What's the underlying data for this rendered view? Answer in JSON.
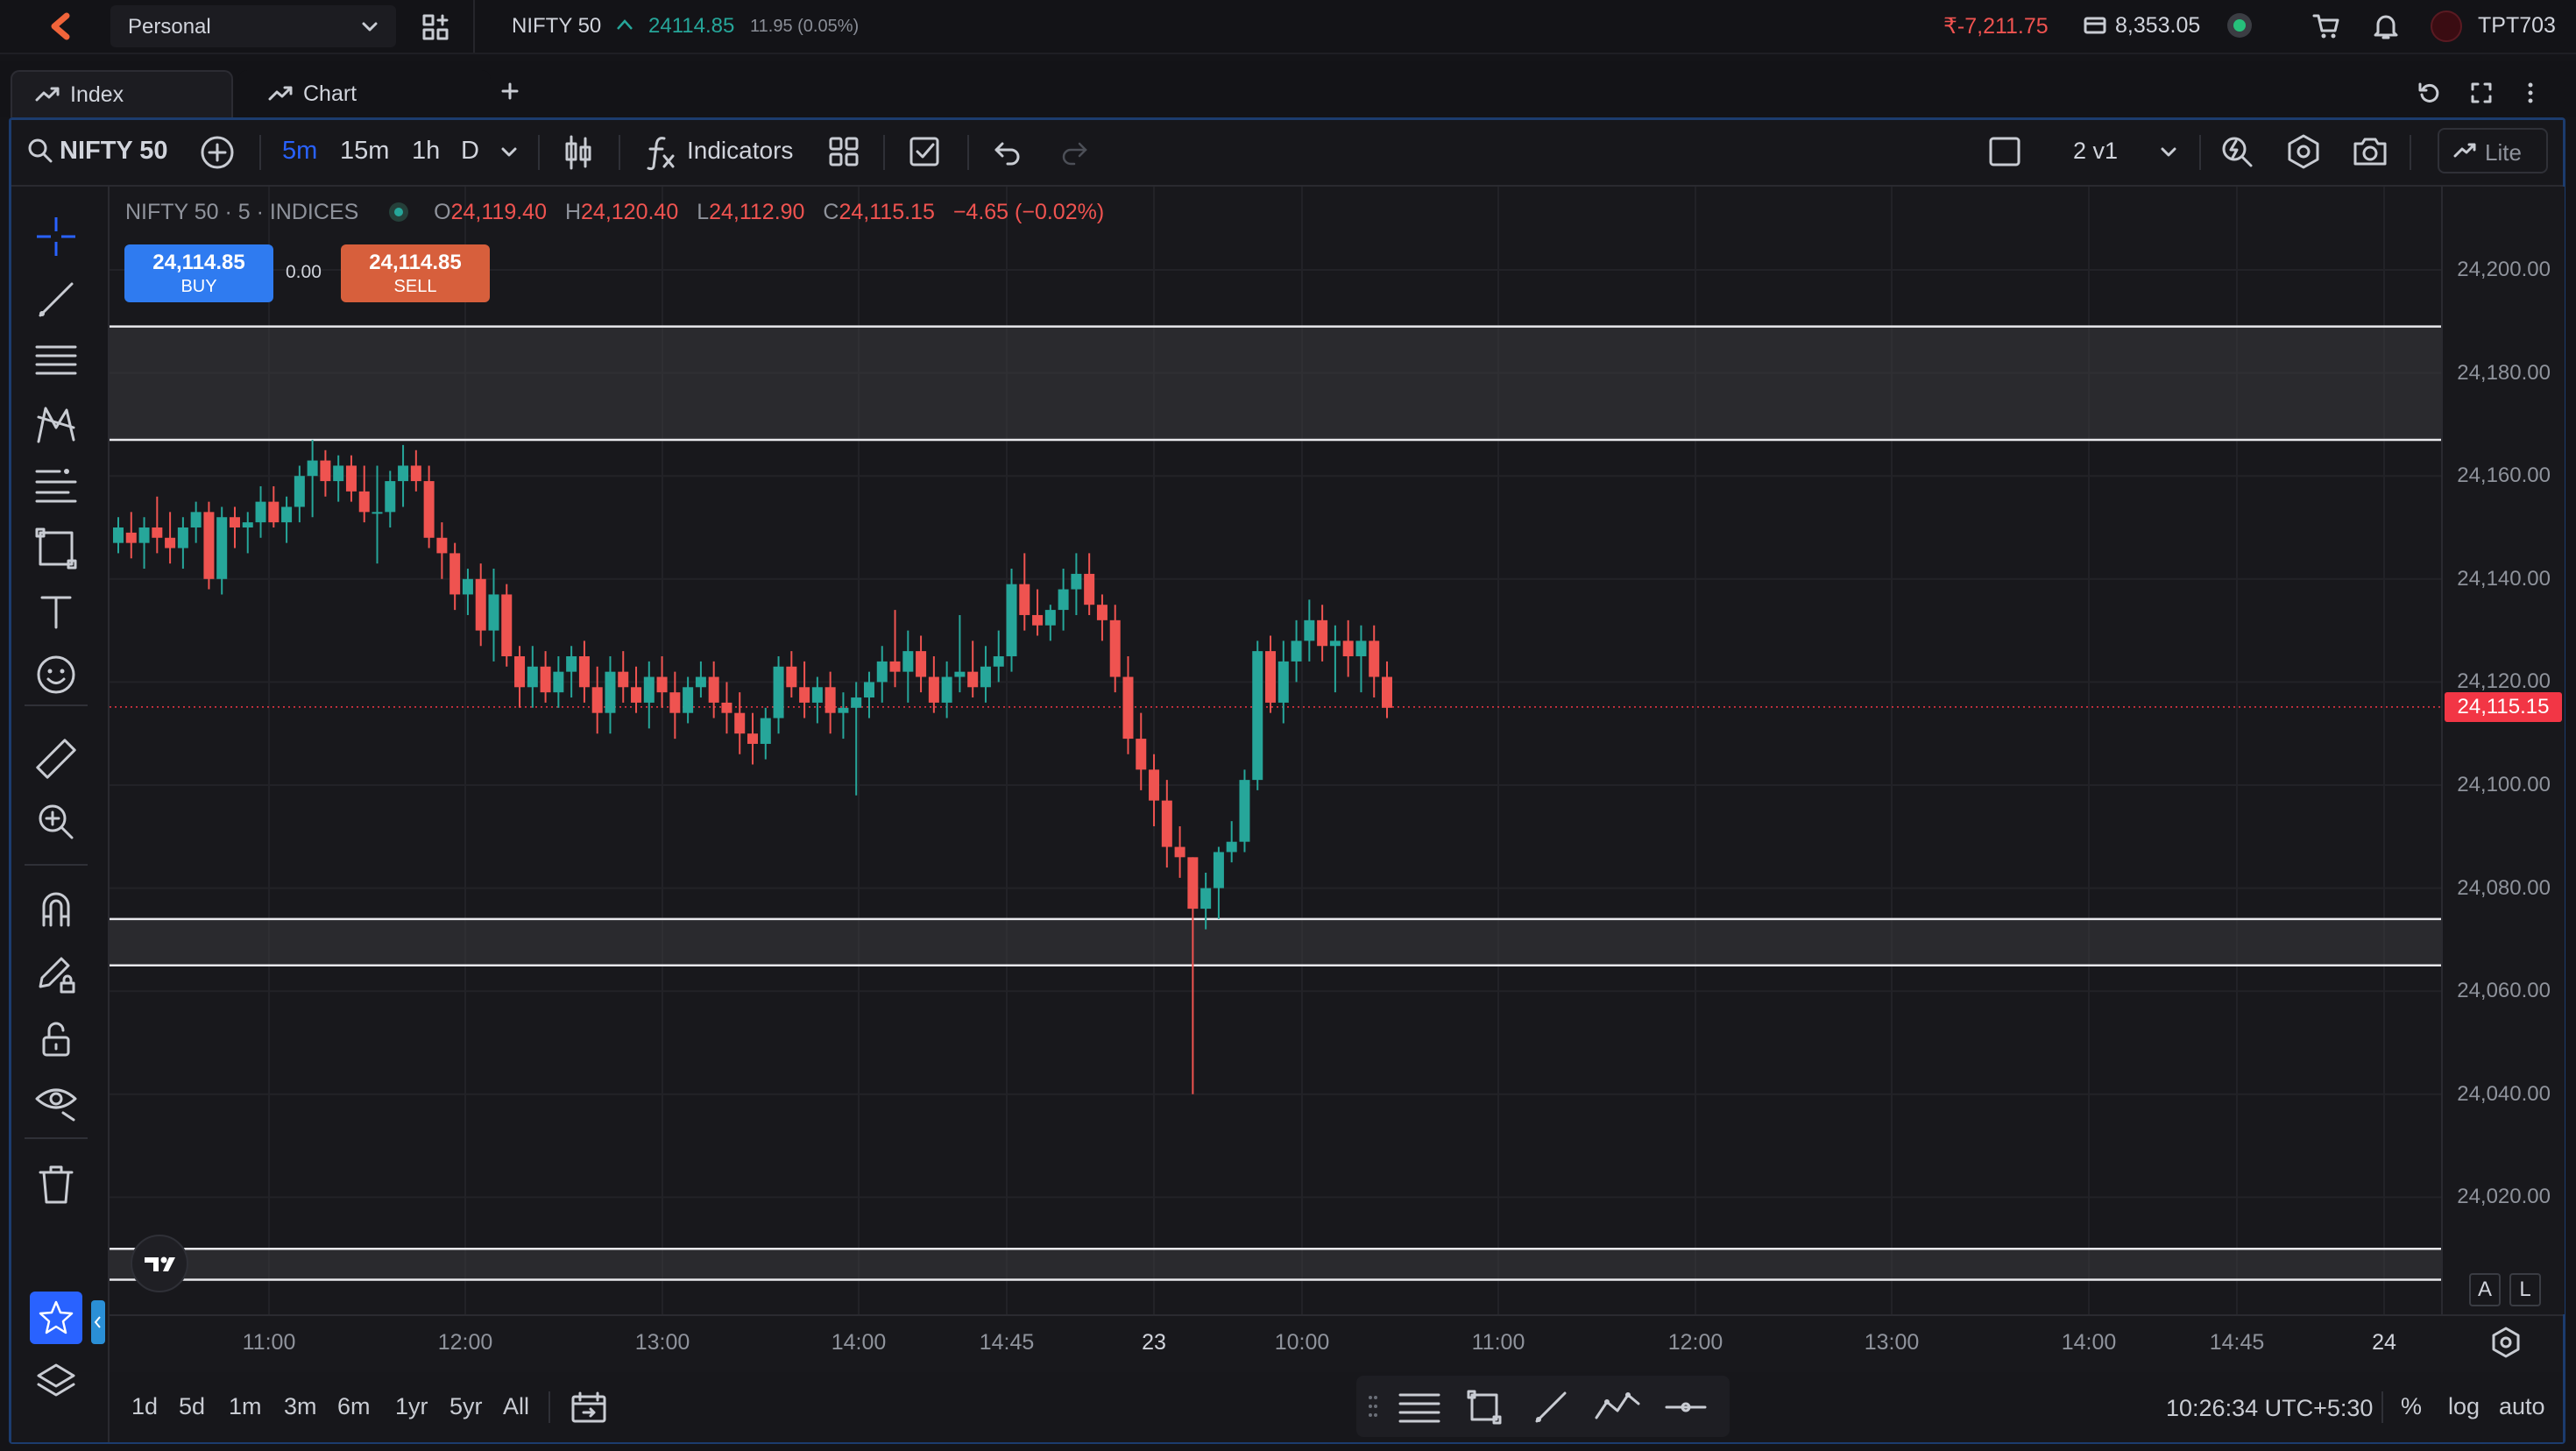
{
  "topbar": {
    "account": "Personal",
    "symbol": "NIFTY 50",
    "price": "24114.85",
    "change": "11.95 (0.05%)",
    "pnl": "₹-7,211.75",
    "balance": "8,353.05",
    "user": "TPT703"
  },
  "tabs": [
    {
      "label": "Index"
    },
    {
      "label": "Chart"
    }
  ],
  "toolbar": {
    "symbol": "NIFTY 50",
    "intervals": [
      "5m",
      "15m",
      "1h",
      "D"
    ],
    "indicators_label": "Indicators",
    "layout_label": "2 v1",
    "lite_label": "Lite"
  },
  "legend": {
    "title": "NIFTY 50 · 5 · INDICES",
    "o_label": "O",
    "o": "24,119.40",
    "h_label": "H",
    "h": "24,120.40",
    "l_label": "L",
    "l": "24,112.90",
    "c_label": "C",
    "c": "24,115.15",
    "change": "−4.65 (−0.02%)"
  },
  "trade": {
    "buy_price": "24,114.85",
    "buy_label": "BUY",
    "spread": "0.00",
    "sell_price": "24,114.85",
    "sell_label": "SELL"
  },
  "price_axis": [
    "24,200.00",
    "24,180.00",
    "24,160.00",
    "24,140.00",
    "24,120.00",
    "24,100.00",
    "24,080.00",
    "24,060.00",
    "24,040.00",
    "24,020.00"
  ],
  "current_price_tag": "24,115.15",
  "time_axis": [
    "11:00",
    "12:00",
    "13:00",
    "14:00",
    "14:45",
    "23",
    "10:00",
    "11:00",
    "12:00",
    "13:00",
    "14:00",
    "14:45",
    "24"
  ],
  "axis_buttons": {
    "a": "A",
    "l": "L"
  },
  "bottombar": {
    "ranges": [
      "1d",
      "5d",
      "1m",
      "3m",
      "6m",
      "1yr",
      "5yr",
      "All"
    ],
    "time": "10:26:34 UTC+5:30",
    "percent": "%",
    "log": "log",
    "auto": "auto"
  },
  "colors": {
    "up": "#26a69a",
    "down": "#ef5350",
    "buy": "#2f7bf0",
    "sell": "#d75f3c",
    "accent": "#2962ff",
    "price_tag": "#f23645"
  },
  "chart_data": {
    "type": "candlestick",
    "title": "NIFTY 50 · 5 · INDICES",
    "ylim": [
      24010,
      24210
    ],
    "x_ticks": [
      "11:00",
      "12:00",
      "13:00",
      "14:00",
      "14:45",
      "23",
      "10:00",
      "11:00",
      "12:00",
      "13:00",
      "14:00",
      "14:45",
      "24"
    ],
    "y_ticks": [
      24200,
      24180,
      24160,
      24140,
      24120,
      24100,
      24080,
      24060,
      24040,
      24020
    ],
    "last_price": 24115.15,
    "zones": [
      [
        24167,
        24189
      ],
      [
        24065,
        24074
      ],
      [
        24004,
        24010
      ]
    ],
    "candles": [
      [
        24147,
        24152,
        24145,
        24150
      ],
      [
        24149,
        24153,
        24144,
        24147
      ],
      [
        24147,
        24152,
        24142,
        24150
      ],
      [
        24150,
        24156,
        24145,
        24148
      ],
      [
        24148,
        24153,
        24143,
        24146
      ],
      [
        24146,
        24152,
        24142,
        24150
      ],
      [
        24150,
        24155,
        24147,
        24153
      ],
      [
        24153,
        24155,
        24138,
        24140
      ],
      [
        24140,
        24154,
        24137,
        24152
      ],
      [
        24152,
        24154,
        24146,
        24150
      ],
      [
        24150,
        24153,
        24145,
        24151
      ],
      [
        24151,
        24158,
        24148,
        24155
      ],
      [
        24155,
        24158,
        24150,
        24151
      ],
      [
        24151,
        24156,
        24147,
        24154
      ],
      [
        24154,
        24162,
        24151,
        24160
      ],
      [
        24160,
        24167,
        24152,
        24163
      ],
      [
        24163,
        24165,
        24156,
        24159
      ],
      [
        24159,
        24164,
        24155,
        24162
      ],
      [
        24162,
        24164,
        24155,
        24157
      ],
      [
        24157,
        24162,
        24151,
        24153
      ],
      [
        24153,
        24162,
        24143,
        24153
      ],
      [
        24153,
        24161,
        24150,
        24159
      ],
      [
        24159,
        24166,
        24154,
        24162
      ],
      [
        24162,
        24165,
        24157,
        24159
      ],
      [
        24159,
        24162,
        24146,
        24148
      ],
      [
        24148,
        24151,
        24140,
        24145
      ],
      [
        24145,
        24147,
        24134,
        24137
      ],
      [
        24137,
        24142,
        24133,
        24140
      ],
      [
        24140,
        24143,
        24127,
        24130
      ],
      [
        24130,
        24142,
        24124,
        24137
      ],
      [
        24137,
        24139,
        24123,
        24125
      ],
      [
        24125,
        24127,
        24115,
        24119
      ],
      [
        24119,
        24127,
        24115,
        24123
      ],
      [
        24123,
        24126,
        24116,
        24118
      ],
      [
        24118,
        24125,
        24115,
        24122
      ],
      [
        24122,
        24127,
        24117,
        24125
      ],
      [
        24125,
        24128,
        24116,
        24119
      ],
      [
        24119,
        24123,
        24110,
        24114
      ],
      [
        24114,
        24125,
        24110,
        24122
      ],
      [
        24122,
        24126,
        24116,
        24119
      ],
      [
        24119,
        24123,
        24114,
        24116
      ],
      [
        24116,
        24124,
        24111,
        24121
      ],
      [
        24121,
        24125,
        24115,
        24118
      ],
      [
        24118,
        24122,
        24109,
        24114
      ],
      [
        24114,
        24121,
        24112,
        24119
      ],
      [
        24119,
        24124,
        24117,
        24121
      ],
      [
        24121,
        24124,
        24113,
        24116
      ],
      [
        24116,
        24120,
        24110,
        24114
      ],
      [
        24114,
        24118,
        24106,
        24110
      ],
      [
        24110,
        24114,
        24104,
        24108
      ],
      [
        24108,
        24115,
        24105,
        24113
      ],
      [
        24113,
        24125,
        24110,
        24123
      ],
      [
        24123,
        24126,
        24117,
        24119
      ],
      [
        24119,
        24124,
        24113,
        24116
      ],
      [
        24116,
        24121,
        24112,
        24119
      ],
      [
        24119,
        24122,
        24110,
        24114
      ],
      [
        24114,
        24118,
        24109,
        24115
      ],
      [
        24115,
        24120,
        24098,
        24117
      ],
      [
        24117,
        24122,
        24113,
        24120
      ],
      [
        24120,
        24127,
        24116,
        24124
      ],
      [
        24124,
        24134,
        24119,
        24122
      ],
      [
        24122,
        24130,
        24116,
        24126
      ],
      [
        24126,
        24129,
        24118,
        24121
      ],
      [
        24121,
        24125,
        24114,
        24116
      ],
      [
        24116,
        24124,
        24113,
        24121
      ],
      [
        24121,
        24133,
        24118,
        24122
      ],
      [
        24122,
        24128,
        24117,
        24119
      ],
      [
        24119,
        24127,
        24116,
        24123
      ],
      [
        24123,
        24130,
        24120,
        24125
      ],
      [
        24125,
        24142,
        24122,
        24139
      ],
      [
        24139,
        24145,
        24130,
        24133
      ],
      [
        24133,
        24138,
        24129,
        24131
      ],
      [
        24131,
        24135,
        24128,
        24134
      ],
      [
        24134,
        24142,
        24130,
        24138
      ],
      [
        24138,
        24145,
        24133,
        24141
      ],
      [
        24141,
        24145,
        24133,
        24135
      ],
      [
        24135,
        24137,
        24128,
        24132
      ],
      [
        24132,
        24135,
        24118,
        24121
      ],
      [
        24121,
        24125,
        24106,
        24109
      ],
      [
        24109,
        24114,
        24099,
        24103
      ],
      [
        24103,
        24106,
        24092,
        24097
      ],
      [
        24097,
        24101,
        24084,
        24088
      ],
      [
        24088,
        24092,
        24082,
        24086
      ],
      [
        24086,
        24078,
        24040,
        24076
      ],
      [
        24076,
        24083,
        24072,
        24080
      ],
      [
        24080,
        24088,
        24074,
        24087
      ],
      [
        24087,
        24093,
        24085,
        24089
      ],
      [
        24089,
        24103,
        24087,
        24101
      ],
      [
        24101,
        24128,
        24099,
        24126
      ],
      [
        24126,
        24129,
        24114,
        24116
      ],
      [
        24116,
        24128,
        24112,
        24124
      ],
      [
        24124,
        24132,
        24120,
        24128
      ],
      [
        24128,
        24136,
        24124,
        24132
      ],
      [
        24132,
        24135,
        24124,
        24127
      ],
      [
        24127,
        24131,
        24118,
        24128
      ],
      [
        24128,
        24132,
        24121,
        24125
      ],
      [
        24125,
        24131,
        24118,
        24128
      ],
      [
        24128,
        24131,
        24117,
        24121
      ],
      [
        24121,
        24124,
        24113,
        24115
      ]
    ]
  }
}
